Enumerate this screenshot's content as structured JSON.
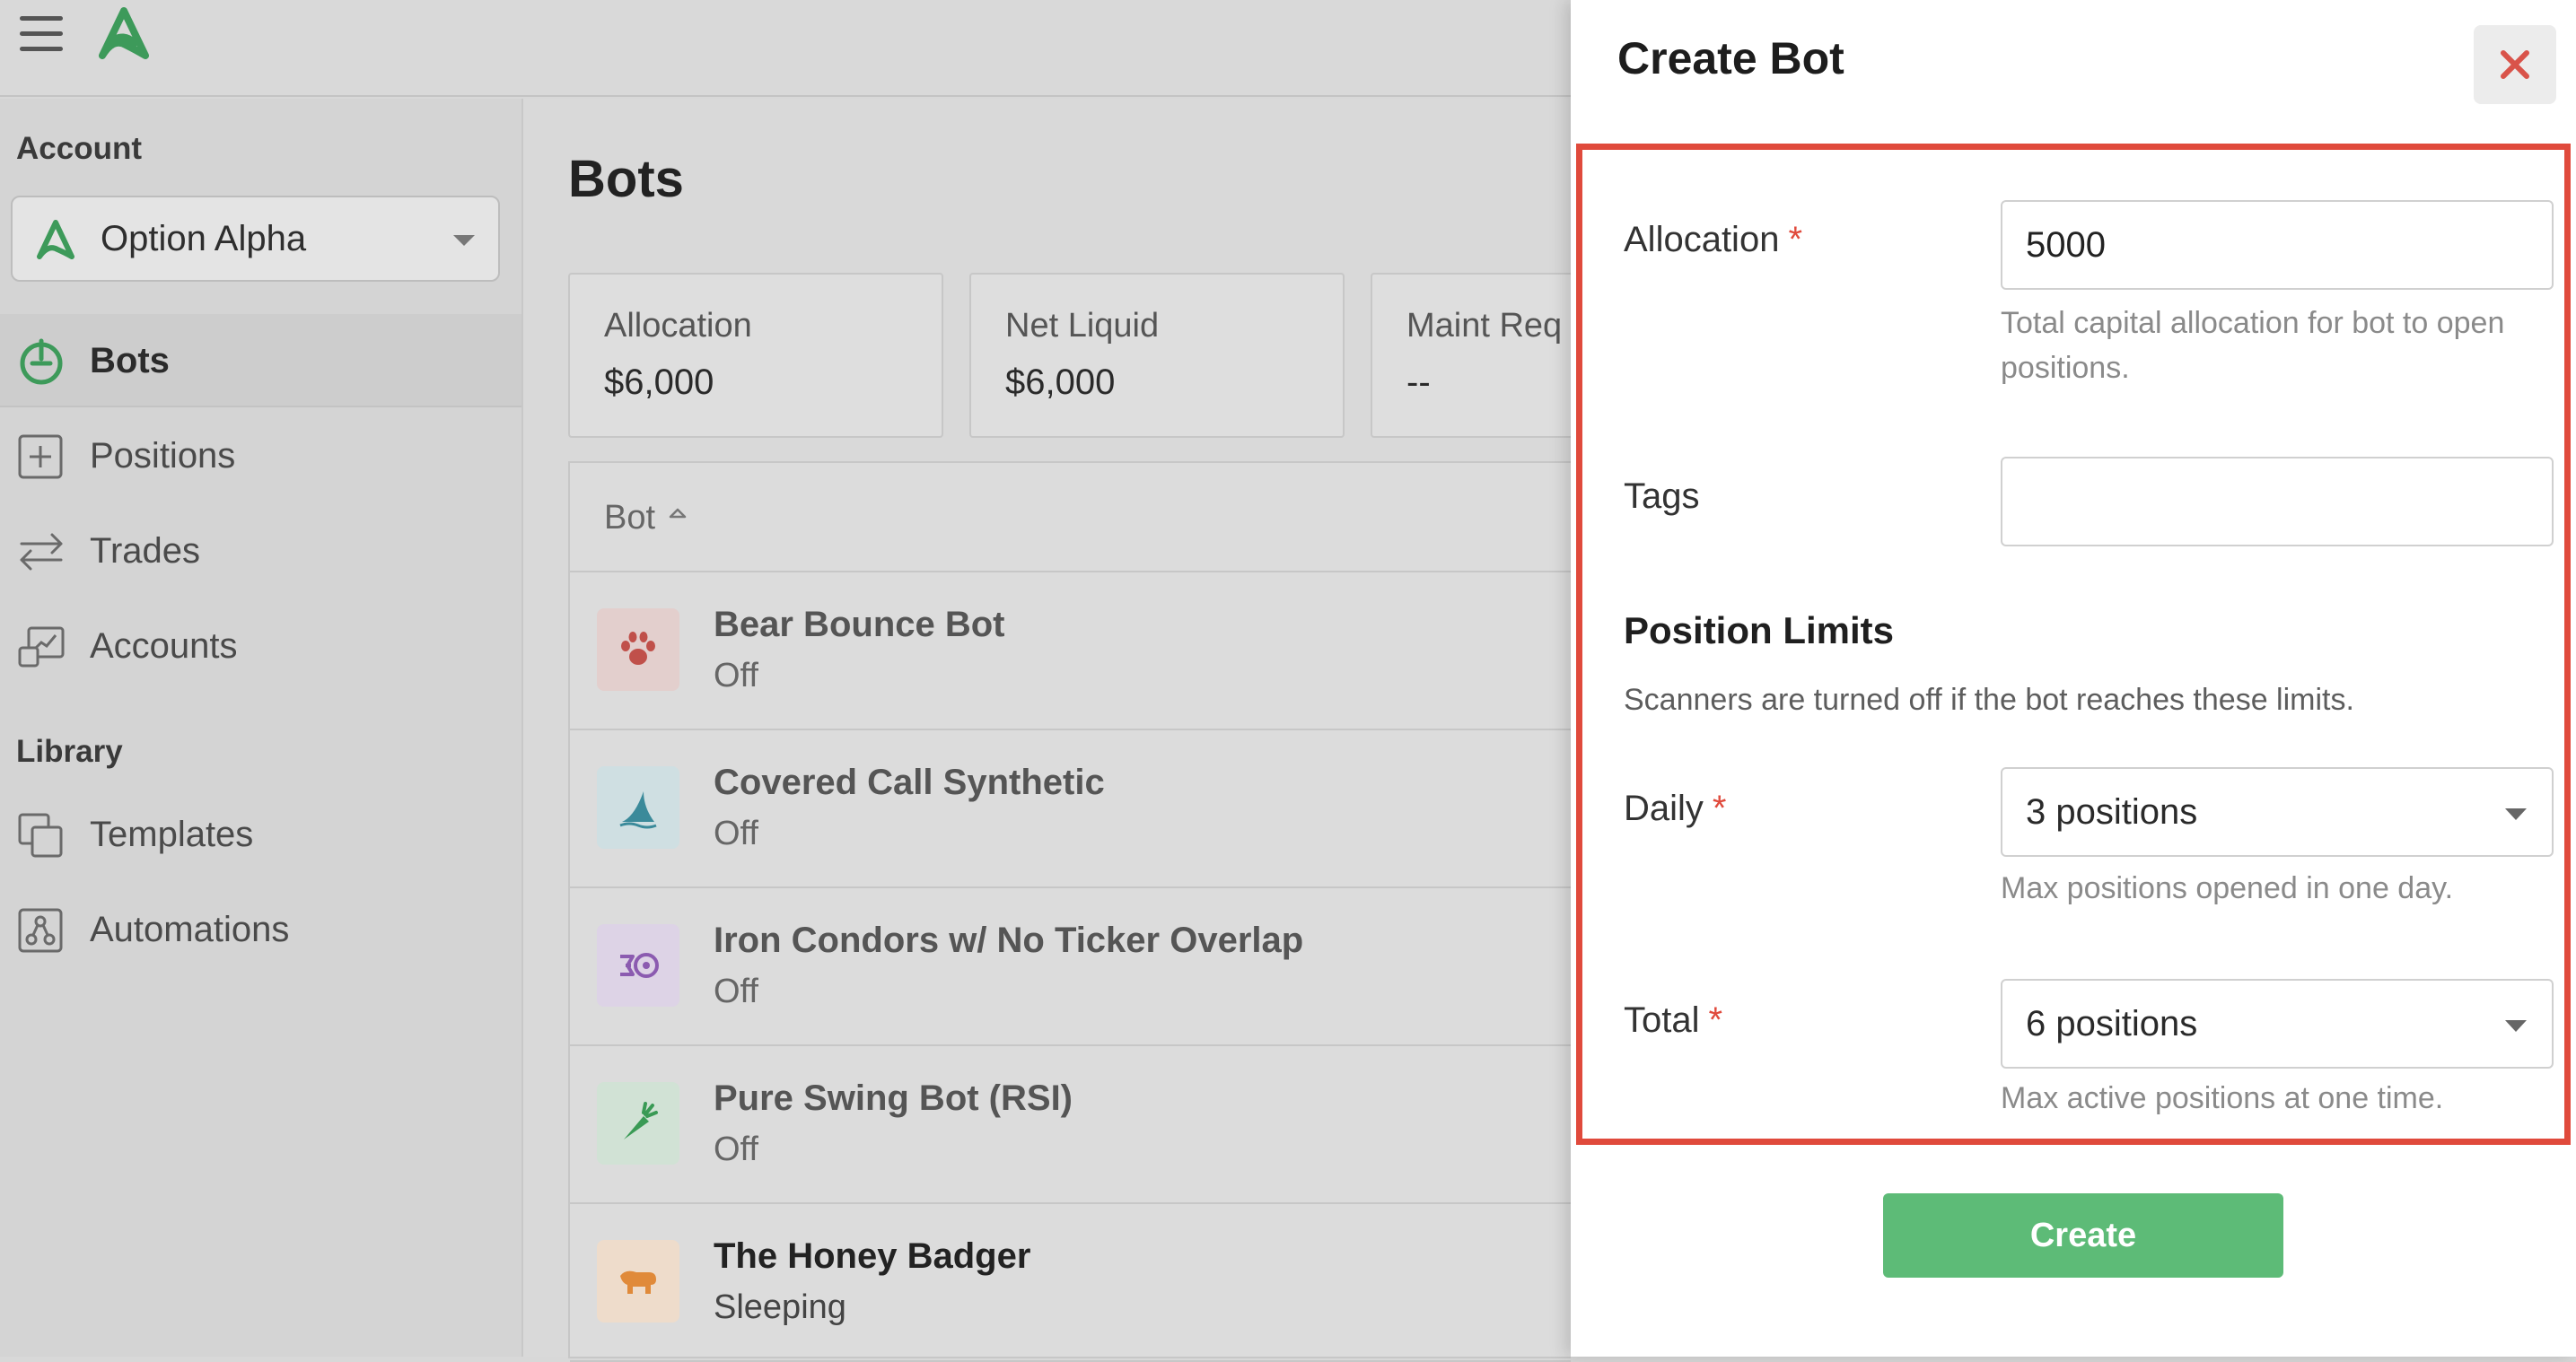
{
  "header": {
    "menu_icon": "hamburger-menu-icon",
    "logo_icon": "option-alpha-logo"
  },
  "sidebar": {
    "account_section": "Account",
    "account_select": {
      "value": "Option Alpha",
      "icon": "option-alpha-logo"
    },
    "nav_items": [
      {
        "label": "Bots",
        "icon": "bots-power-icon",
        "active": true
      },
      {
        "label": "Positions",
        "icon": "plus-square-icon",
        "active": false
      },
      {
        "label": "Trades",
        "icon": "trades-arrows-icon",
        "active": false
      },
      {
        "label": "Accounts",
        "icon": "accounts-chart-icon",
        "active": false
      }
    ],
    "library_section": "Library",
    "library_items": [
      {
        "label": "Templates",
        "icon": "templates-copy-icon"
      },
      {
        "label": "Automations",
        "icon": "automations-nodes-icon"
      }
    ]
  },
  "main": {
    "title": "Bots",
    "stats": [
      {
        "label": "Allocation",
        "value": "$6,000"
      },
      {
        "label": "Net Liquid",
        "value": "$6,000"
      },
      {
        "label": "Maint Req",
        "value": "--"
      }
    ],
    "table": {
      "column_header": "Bot",
      "sort_icon": "sort-up-icon",
      "rows": [
        {
          "name": "Bear Bounce Bot",
          "status": "Off",
          "icon": "paw-icon",
          "icon_color": "#c0504a",
          "icon_bg": "#e3cfcd"
        },
        {
          "name": "Covered Call Synthetic",
          "status": "Off",
          "icon": "shark-fin-icon",
          "icon_color": "#3b8a9a",
          "icon_bg": "#cfdfe2"
        },
        {
          "name": "Iron Condors w/ No Ticker Overlap",
          "status": "Off",
          "icon": "condor-icon",
          "icon_color": "#8b5bb0",
          "icon_bg": "#ddd3e6"
        },
        {
          "name": "Pure Swing Bot (RSI)",
          "status": "Off",
          "icon": "carrot-icon",
          "icon_color": "#3a9a55",
          "icon_bg": "#d1e2d5"
        },
        {
          "name": "The Honey Badger",
          "status": "Sleeping",
          "icon": "badger-icon",
          "icon_color": "#e08a3a",
          "icon_bg": "#eedccb"
        }
      ]
    }
  },
  "drawer": {
    "title": "Create Bot",
    "close_icon": "close-x-icon",
    "allocation": {
      "label": "Allocation",
      "required_mark": "*",
      "value": "5000",
      "helper": "Total capital allocation for bot to open positions."
    },
    "tags": {
      "label": "Tags",
      "value": ""
    },
    "position_limits": {
      "title": "Position Limits",
      "subtitle": "Scanners are turned off if the bot reaches these limits.",
      "daily": {
        "label": "Daily",
        "required_mark": "*",
        "value": "3 positions",
        "helper": "Max positions opened in one day."
      },
      "total": {
        "label": "Total",
        "required_mark": "*",
        "value": "6 positions",
        "helper": "Max active positions at one time."
      }
    },
    "create_label": "Create",
    "colors": {
      "accent": "#5dbb77",
      "highlight_border": "#e04a3c",
      "close_x": "#d9534a"
    }
  }
}
